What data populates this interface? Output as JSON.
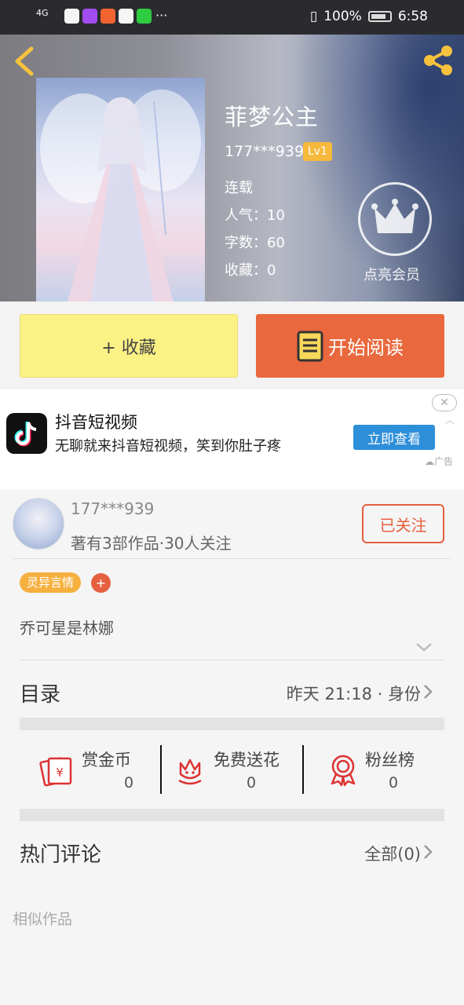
{
  "status_bar": {
    "signal": "4G",
    "more": "···",
    "battery": "100%",
    "time": "6:58"
  },
  "book": {
    "title": "菲梦公主",
    "author_id": "177***939",
    "level": "Lv1",
    "status": "连载",
    "popularity": "人气：10",
    "word_count": "字数：60",
    "favorites": "收藏：0",
    "vip_label": "点亮会员"
  },
  "actions": {
    "collect_label": "+ 收藏",
    "read_label": "开始阅读"
  },
  "ad": {
    "title": "抖音短视频",
    "description": "无聊就来抖音短视频，笑到你肚子疼",
    "button": "立即查看",
    "tag": "广告",
    "close": "✕",
    "chevron": "︿"
  },
  "author": {
    "name": "177***939",
    "stats": "著有3部作品·30人关注",
    "follow_label": "已关注"
  },
  "tags": {
    "genre": "灵异言情",
    "add": "+"
  },
  "intro": "乔可星是林娜",
  "catalog": {
    "title": "目录",
    "update_info": "昨天 21:18 · 身份"
  },
  "gifts": [
    {
      "label": "赏金币",
      "value": "0",
      "icon": "red-envelope-icon"
    },
    {
      "label": "免费送花",
      "value": "0",
      "icon": "flower-icon"
    },
    {
      "label": "粉丝榜",
      "value": "0",
      "icon": "medal-icon"
    }
  ],
  "comments": {
    "title": "热门评论",
    "all_label": "全部(0)"
  },
  "similar_title": "相似作品",
  "colors": {
    "accent_orange": "#e9683d",
    "collect_yellow": "#fbf185",
    "tag_orange": "#f6b03f",
    "ad_blue": "#2e8fd9"
  }
}
